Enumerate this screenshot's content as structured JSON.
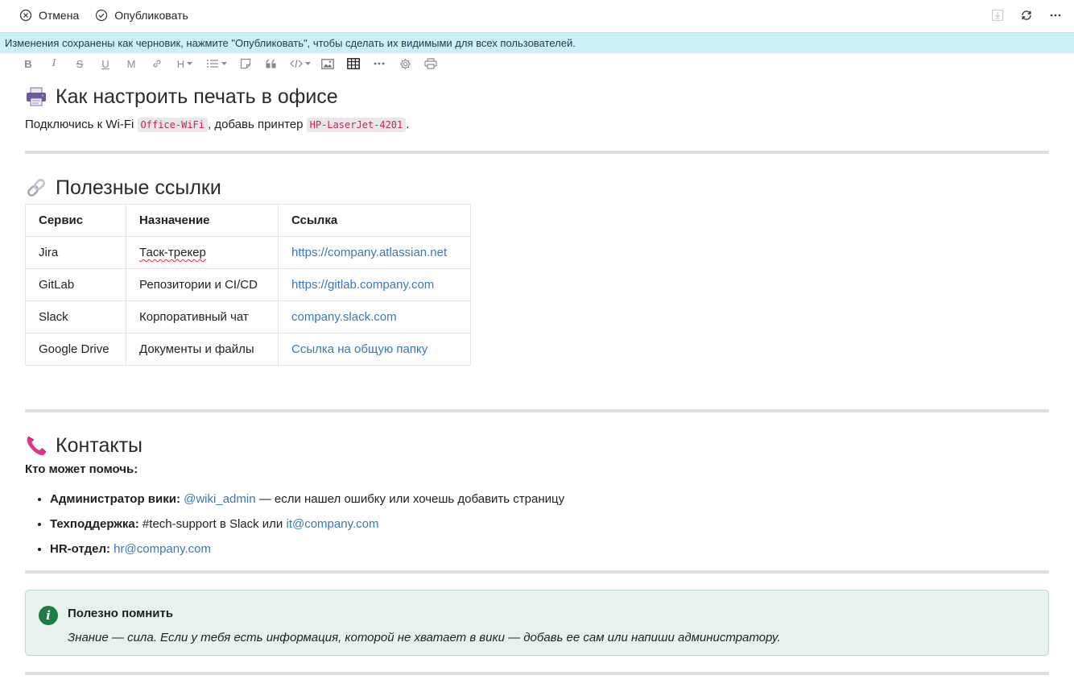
{
  "commands": {
    "cancel_label": "Отмена",
    "publish_label": "Опубликовать"
  },
  "banner": {
    "text": "Изменения сохранены как черновик, нажмите \"Опубликовать\", чтобы сделать их видимыми для всех пользователей."
  },
  "toolbar": {
    "bold": "B",
    "italic": "I",
    "strike": "S",
    "underline": "U",
    "mark": "M",
    "heading": "H"
  },
  "section_print": {
    "title": "Как настроить печать в офисе",
    "text_before": "Подключись к Wi-Fi ",
    "wifi": "Office-WiFi",
    "text_middle": ", добавь принтер ",
    "printer": "HP-LaserJet-4201",
    "text_after": "."
  },
  "section_links": {
    "title": "Полезные ссылки",
    "headers": [
      "Сервис",
      "Назначение",
      "Ссылка"
    ],
    "rows": [
      {
        "service": "Jira",
        "purpose": "Таск-трекер",
        "link": "https://company.atlassian.net"
      },
      {
        "service": "GitLab",
        "purpose": "Репозитории и CI/CD",
        "link": "https://gitlab.company.com"
      },
      {
        "service": "Slack",
        "purpose": "Корпоративный чат",
        "link": "company.slack.com"
      },
      {
        "service": "Google Drive",
        "purpose": "Документы и файлы",
        "link": "Ссылка на общую папку"
      }
    ]
  },
  "section_contacts": {
    "title": "Контакты",
    "subtitle": "Кто может помочь:",
    "items": [
      {
        "label": "Администратор вики:",
        "link": "@wiki_admin",
        "text": " — если нашел ошибку или хочешь добавить страницу"
      },
      {
        "label": "Техподдержка:",
        "text": " #tech-support в Slack или ",
        "link": "it@company.com"
      },
      {
        "label": "HR-отдел:",
        "link": "hr@company.com"
      }
    ]
  },
  "note": {
    "title": "Полезно помнить",
    "body": "Знание — сила. Если у тебя есть информация, которой не хватает в вики — добавь ее сам или напиши администратору."
  },
  "colors": {
    "banner_bg": "#cdf0f8",
    "link": "#3a77b8",
    "code_text": "#c7254e",
    "note_bg": "#e8f2ec",
    "note_icon": "#1e7d43"
  }
}
